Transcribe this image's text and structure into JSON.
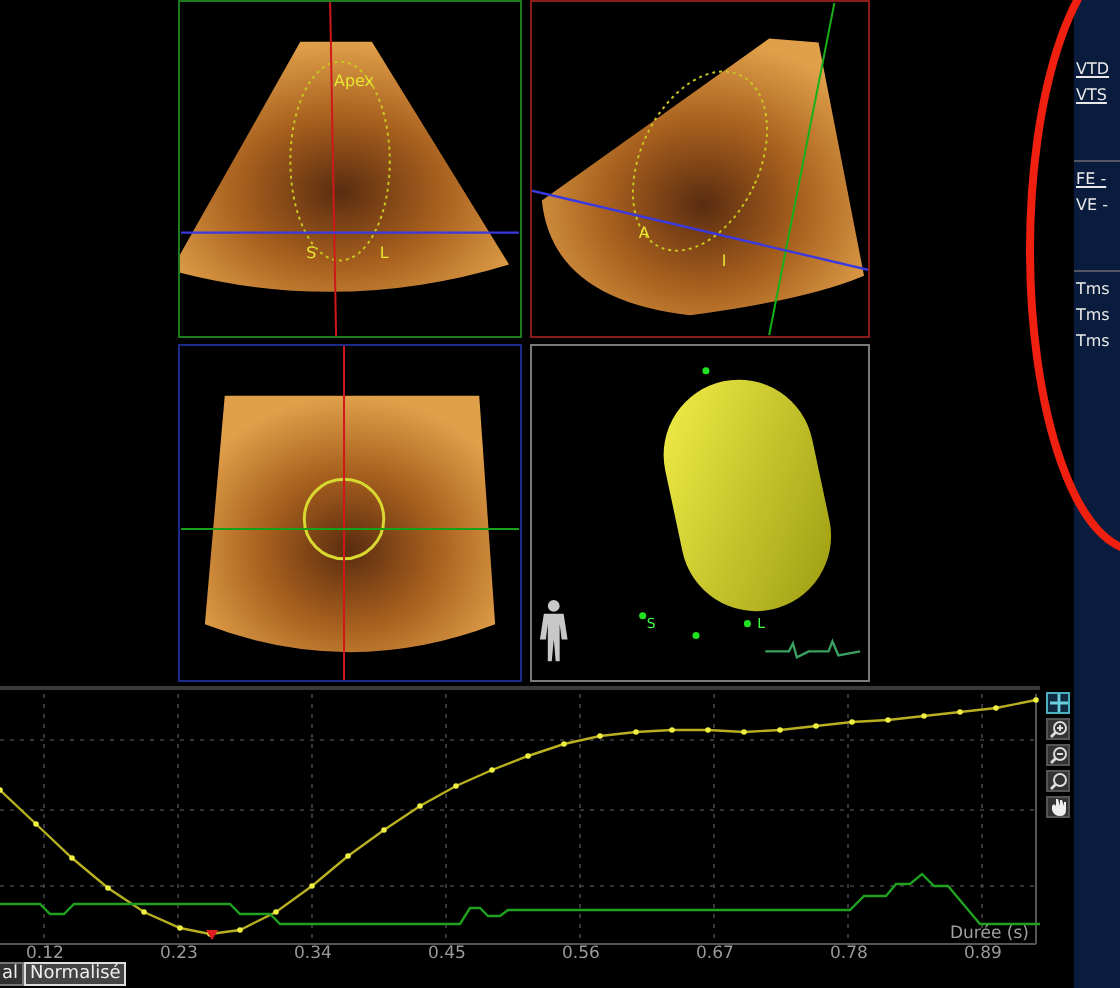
{
  "views": [
    {
      "kind": "sector",
      "color": "#1d7a1d",
      "labels": [
        "Apex",
        "S",
        "L"
      ]
    },
    {
      "kind": "sector",
      "color": "#8a1c1c",
      "labels": [
        "A",
        "I"
      ]
    },
    {
      "kind": "short_axis",
      "color": "#1c2a8c"
    },
    {
      "kind": "model_3d",
      "color": "#7a7a7a",
      "labels": [
        "S",
        "L"
      ]
    }
  ],
  "chart": {
    "x_ticks": [
      "0.12",
      "0.23",
      "0.34",
      "0.45",
      "0.56",
      "0.67",
      "0.78",
      "0.89"
    ],
    "axis_label": "Durée (s)"
  },
  "tools": [
    {
      "kind": "crosshair",
      "selected": true
    },
    {
      "kind": "zoom_in",
      "selected": false
    },
    {
      "kind": "zoom_out",
      "selected": false
    },
    {
      "kind": "zoom_fit",
      "selected": false
    },
    {
      "kind": "pan",
      "selected": false
    }
  ],
  "tabs": [
    {
      "label": "al",
      "selected": false
    },
    {
      "label": "Normalisé",
      "selected": true
    }
  ],
  "measurements": [
    [
      {
        "text": "VTD",
        "link": true
      },
      {
        "text": "VTS",
        "link": true
      }
    ],
    [
      {
        "text": "FE -",
        "link": true
      },
      {
        "text": "VE -",
        "link": false
      }
    ],
    [
      {
        "text": "Tms",
        "link": false
      },
      {
        "text": "Tms",
        "link": false
      },
      {
        "text": "Tms",
        "link": false
      }
    ]
  ]
}
